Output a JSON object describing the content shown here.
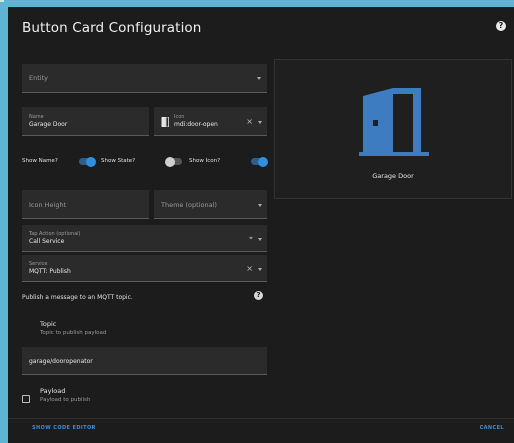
{
  "dialog": {
    "title": "Button Card Configuration"
  },
  "form": {
    "entity": {
      "placeholder": "Entity"
    },
    "name": {
      "label": "Name",
      "value": "Garage Door"
    },
    "icon": {
      "label": "Icon",
      "value": "mdi:door-open"
    },
    "toggles": [
      {
        "label": "Show Name?",
        "checked": true
      },
      {
        "label": "Show State?",
        "checked": false
      },
      {
        "label": "Show Icon?",
        "checked": true
      }
    ],
    "icon_height": {
      "placeholder": "Icon Height"
    },
    "theme": {
      "placeholder": "Theme (optional)"
    },
    "tap_action": {
      "label": "Tap Action (optional)",
      "value": "Call Service"
    },
    "service": {
      "label": "Service",
      "value": "MQTT: Publish"
    },
    "service_description": "Publish a message to an MQTT topic.",
    "topic": {
      "title": "Topic",
      "description": "Topic to publish payload",
      "value": "garage/dooropenator"
    },
    "payload": {
      "title": "Payload",
      "description": "Payload to publish"
    }
  },
  "preview": {
    "name": "Garage Door",
    "icon": "door-open-icon",
    "icon_color": "#3d7cc0"
  },
  "footer": {
    "code_editor_label": "SHOW CODE EDITOR",
    "cancel_label": "CANCEL"
  },
  "colors": {
    "accent": "#2f8fe0",
    "background": "#1c1c1c",
    "field": "#2b2b2b"
  }
}
